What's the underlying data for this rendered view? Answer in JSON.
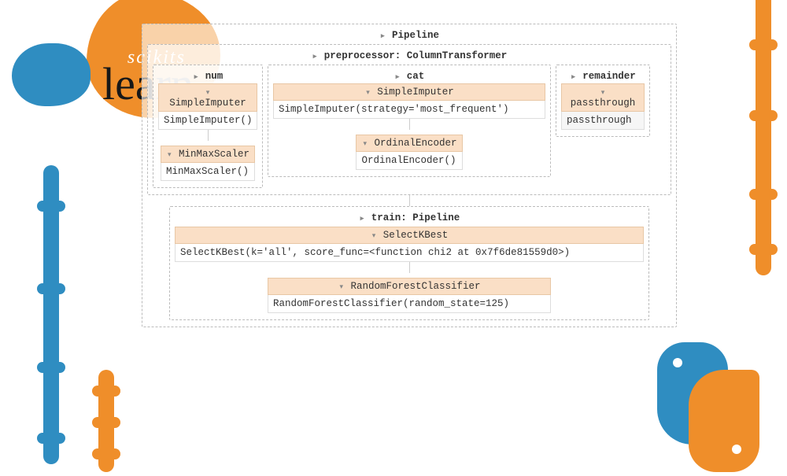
{
  "brand": {
    "top": "scikits",
    "bottom": "learn"
  },
  "colors": {
    "blue": "#2f8dc1",
    "orange": "#ef8e2a",
    "header_bg": "#fadfc6"
  },
  "pipeline": {
    "title": "Pipeline",
    "preprocessor": {
      "title": "preprocessor: ColumnTransformer",
      "columns": {
        "num": {
          "label": "num",
          "imputer": {
            "head": "SimpleImputer",
            "body": "SimpleImputer()"
          },
          "scaler": {
            "head": "MinMaxScaler",
            "body": "MinMaxScaler()"
          }
        },
        "cat": {
          "label": "cat",
          "imputer": {
            "head": "SimpleImputer",
            "body": "SimpleImputer(strategy='most_frequent')"
          },
          "encoder": {
            "head": "OrdinalEncoder",
            "body": "OrdinalEncoder()"
          }
        },
        "remainder": {
          "label": "remainder",
          "passthrough": {
            "head": "passthrough",
            "body": "passthrough"
          }
        }
      }
    },
    "train": {
      "title": "train: Pipeline",
      "selectk": {
        "head": "SelectKBest",
        "body": "SelectKBest(k='all', score_func=<function chi2 at 0x7f6de81559d0>)"
      },
      "rf": {
        "head": "RandomForestClassifier",
        "body": "RandomForestClassifier(random_state=125)"
      }
    }
  }
}
